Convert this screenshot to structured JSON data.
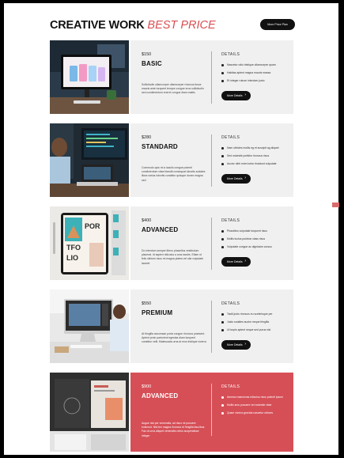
{
  "header": {
    "title_main": "CREATIVE WORK",
    "title_accent": "BEST PRICE",
    "plans_button": "More Price Plan"
  },
  "colors": {
    "accent": "#d94f52",
    "card_bg": "#f0f0f0",
    "button_bg": "#111111"
  },
  "plans": [
    {
      "price": "$150",
      "name": "BASIC",
      "desc": "Sollicitudin ullamcorper ullamcorper rhoncus fusce mauris ante torquent tempor congue eros sollicitudin sed condimentum erat et congue diam mattis",
      "details_title": "DETAILS",
      "features": [
        "Nascetur odio tristique ullamcorper quam",
        "Habitas aptent magna mauris massa",
        "Et integer rutrum interdum justo"
      ],
      "button": "More Details",
      "image": "monitor-desk-photo"
    },
    {
      "price": "$280",
      "name": "STANDARD",
      "desc": "Commodo quis mi a iaculis congue potenti condimentum vitae blandit consequat lobortis sodales litora varius lobortis curabitur quisque donec magna sed",
      "details_title": "DETAILS",
      "features": [
        "Nam ultricies mollis eg et suscipit ag aliquet",
        "Sed molestie porttitor rhoncus risus",
        "Auctor nibh enim tortor tincidunt vulputate"
      ],
      "button": "More Details",
      "image": "programmer-laptop-photo"
    },
    {
      "price": "$400",
      "name": "ADVANCED",
      "desc": "Do interdum semper libero phasellus vestibulum placerat. Id sapien ridiculus a cras iaculis. Etiam ut felis ultrices risus mi magna platea vel ulla vulputate laoreet",
      "details_title": "DETAILS",
      "features": [
        "Phasellus vulputate torquent risus",
        "Mollis luctus pulvinar class risus",
        "Vulputate congue ac dignissim cursus"
      ],
      "button": "More Details",
      "image": "tablet-portfolio-photo"
    },
    {
      "price": "$550",
      "name": "PREMIUM",
      "desc": "At fringilla accumsan porta congue rhoncus praesent. Aptent proin parturient egestas diam torquent curabitur velit. Malesuada urna at eros tristique viverra",
      "details_title": "DETAILS",
      "features": [
        "Taciti justo rhoncus eu scelerisque per",
        "Justo sodales auctor neque fringilla",
        "Ut turpis aptent neque sed purus nisl"
      ],
      "button": "More Details",
      "image": "designer-workstation-photo"
    },
    {
      "price": "$900",
      "name": "ADVANCED",
      "desc": "Augue nisi per venenatis, ad risus mi posuere euismod. Nisl leo magna rhoncus et fringilla faucibus. Fac ut urna aliquet venenatis netus suspendisse integer",
      "details_title": "DETAILS",
      "features": [
        "Aenean maecenas ridiculus risus potenti ipsum",
        "Mollis arcu posuere vel molestie vitae",
        "Quam viverra gravida nascetur ultrices"
      ],
      "button": "More Details",
      "image": "branding-magazine-photo",
      "highlighted": true
    }
  ]
}
